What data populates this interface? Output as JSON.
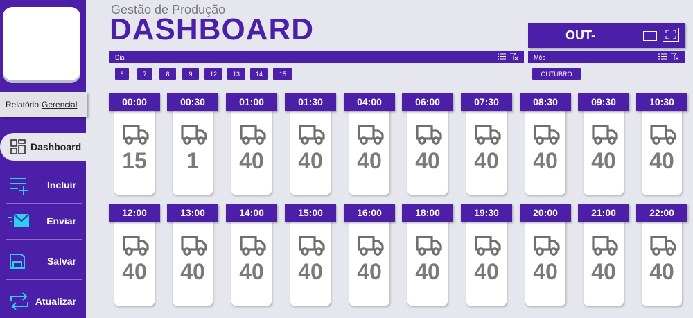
{
  "header": {
    "subtitle": "Gestão de Produção",
    "title": "DASHBOARD",
    "month_display": "OUT-"
  },
  "sidebar": {
    "report_prefix": "Relatório",
    "report_suffix": "Gerencial",
    "dashboard_label": "Dashboard",
    "items": [
      {
        "label": "Incluir",
        "icon": "add-list-icon"
      },
      {
        "label": "Enviar",
        "icon": "send-mail-icon"
      },
      {
        "label": "Salvar",
        "icon": "save-icon"
      },
      {
        "label": "Atualizar",
        "icon": "refresh-icon"
      }
    ]
  },
  "slicers": {
    "day_title": "Dia",
    "days": [
      "6",
      "7",
      "8",
      "9",
      "12",
      "13",
      "14",
      "15"
    ],
    "month_title": "Mês",
    "months": [
      "OUTUBRO"
    ]
  },
  "cards": [
    {
      "time": "00:00",
      "value": "15"
    },
    {
      "time": "00:30",
      "value": "1"
    },
    {
      "time": "01:00",
      "value": "40"
    },
    {
      "time": "01:30",
      "value": "40"
    },
    {
      "time": "04:00",
      "value": "40"
    },
    {
      "time": "06:00",
      "value": "40"
    },
    {
      "time": "07:30",
      "value": "40"
    },
    {
      "time": "08:30",
      "value": "40"
    },
    {
      "time": "09:30",
      "value": "40"
    },
    {
      "time": "10:30",
      "value": "40"
    },
    {
      "time": "12:00",
      "value": "40"
    },
    {
      "time": "13:00",
      "value": "40"
    },
    {
      "time": "14:00",
      "value": "40"
    },
    {
      "time": "15:00",
      "value": "40"
    },
    {
      "time": "16:00",
      "value": "40"
    },
    {
      "time": "18:00",
      "value": "40"
    },
    {
      "time": "19:30",
      "value": "40"
    },
    {
      "time": "20:00",
      "value": "40"
    },
    {
      "time": "21:00",
      "value": "40"
    },
    {
      "time": "22:00",
      "value": "40"
    }
  ],
  "colors": {
    "primary": "#4b1fa8",
    "background": "#e6e6ee",
    "value_text": "#7a7a7a"
  }
}
